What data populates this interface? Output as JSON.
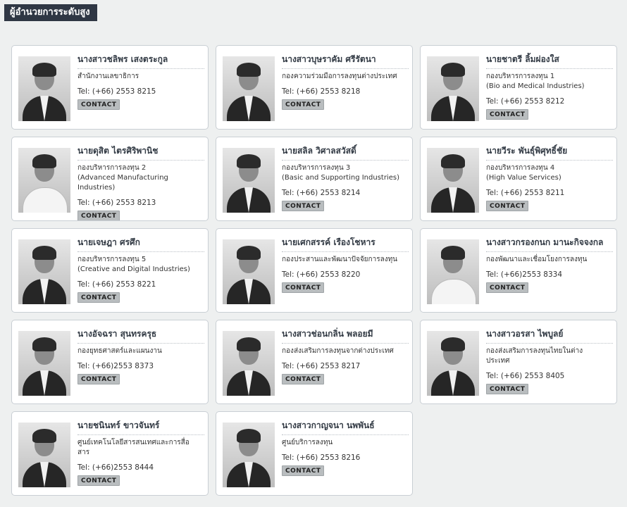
{
  "page": {
    "title": "ผู้อำนวยการระดับสูง",
    "contact_label": "CONTACT",
    "tel_prefix": "Tel: "
  },
  "people": [
    {
      "name": "นางสาวชลิพร เสงตระกูล",
      "dept": [
        "สำนักงานเลขาธิการ"
      ],
      "tel": "(+66) 2553 8215",
      "photo": "female"
    },
    {
      "name": "นางสาวบุษราคัม ศรีรัตนา",
      "dept": [
        "กองความร่วมมือการลงทุนต่างประเทศ"
      ],
      "tel": "(+66) 2553 8218",
      "photo": "female"
    },
    {
      "name": "นายชาตรี ลิ้มผ่องใส",
      "dept": [
        "กองบริหารการลงทุน 1",
        "(Bio and Medical Industries)"
      ],
      "tel": "(+66) 2553 8212",
      "photo": "male"
    },
    {
      "name": "นายดุสิต ไตรศิริพานิช",
      "dept": [
        "กองบริหารการลงทุน 2",
        "(Advanced Manufacturing Industries)"
      ],
      "tel": "(+66) 2553 8213",
      "photo": "uniform"
    },
    {
      "name": "นายสลิล วิศาลสวัสดิ์",
      "dept": [
        "กองบริหารการลงทุน 3",
        "(Basic and Supporting Industries)"
      ],
      "tel": "(+66) 2553 8214",
      "photo": "male"
    },
    {
      "name": "นายวีระ พันธุ์พิศุทธิ์ชัย",
      "dept": [
        "กองบริหารการลงทุน 4",
        "(High Value Services)"
      ],
      "tel": "(+66) 2553 8211",
      "photo": "male"
    },
    {
      "name": "นายเจษฎา ศรศึก",
      "dept": [
        "กองบริหารการลงทุน 5",
        "(Creative and Digital Industries)"
      ],
      "tel": "(+66) 2553 8221",
      "photo": "male"
    },
    {
      "name": "นายเศกสรรค์ เรืองโชหาร",
      "dept": [
        "กองประสานและพัฒนาปัจจัยการลงทุน"
      ],
      "tel": "(+66) 2553 8220",
      "photo": "male"
    },
    {
      "name": "นางสาวกรองกนก มานะกิจจงกล",
      "dept": [
        "กองพัฒนาและเชื่อมโยงการลงทุน"
      ],
      "tel": "(+66)2553 8334",
      "photo": "uniform"
    },
    {
      "name": "นางอัจฉรา สุนทรครุธ",
      "dept": [
        "กองยุทธศาสตร์และแผนงาน"
      ],
      "tel": "(+66)2553 8373",
      "photo": "female"
    },
    {
      "name": "นางสาวช่อนกลิ่น พลอยมี",
      "dept": [
        "กองส่งเสริมการลงทุนจากต่างประเทศ"
      ],
      "tel": "(+66) 2553 8217",
      "photo": "female"
    },
    {
      "name": "นางสาวอรสา ไพบูลย์",
      "dept": [
        "กองส่งเสริมการลงทุนไทยในต่าง",
        "ประเทศ"
      ],
      "tel": "(+66) 2553 8405",
      "photo": "female"
    },
    {
      "name": "นายชนินทร์ ขาวจันทร์",
      "dept": [
        "ศูนย์เทคโนโลยีสารสนเทศและการสื่อ",
        "สาร"
      ],
      "tel": "(+66)2553 8444",
      "photo": "male"
    },
    {
      "name": "นางสาวกาญจนา นพพันธ์",
      "dept": [
        "ศูนย์บริการลงทุน"
      ],
      "tel": "(+66) 2553 8216",
      "photo": "female"
    }
  ]
}
